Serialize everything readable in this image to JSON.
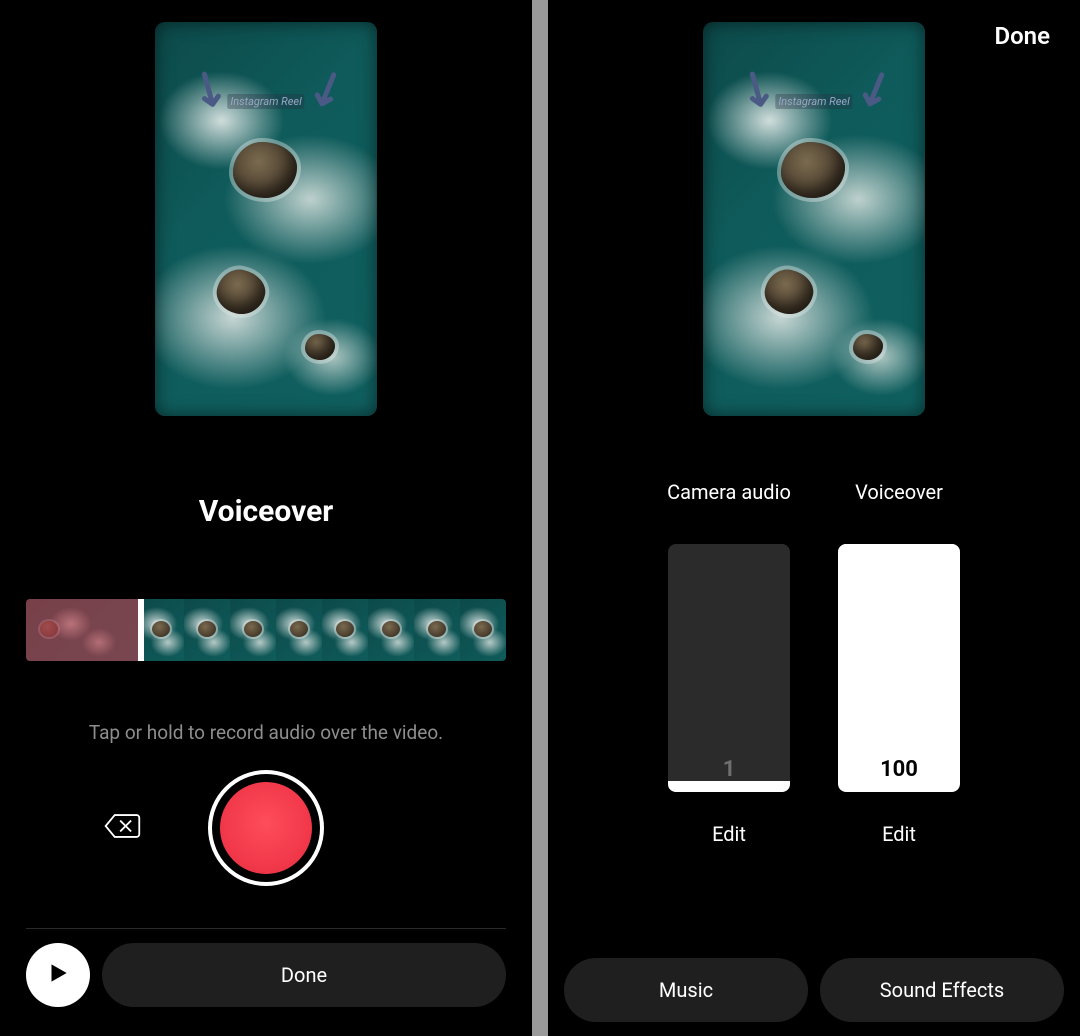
{
  "overlay_text": "Instagram Reel",
  "left": {
    "title": "Voiceover",
    "hint": "Tap or hold to record audio over the video.",
    "done_label": "Done",
    "recorded_fraction_percent": 23
  },
  "right": {
    "done_label": "Done",
    "sliders": {
      "camera": {
        "label": "Camera audio",
        "value": 1,
        "edit": "Edit"
      },
      "voiceover": {
        "label": "Voiceover",
        "value": 100,
        "edit": "Edit"
      }
    },
    "buttons": {
      "music": "Music",
      "sound_effects": "Sound Effects"
    }
  }
}
